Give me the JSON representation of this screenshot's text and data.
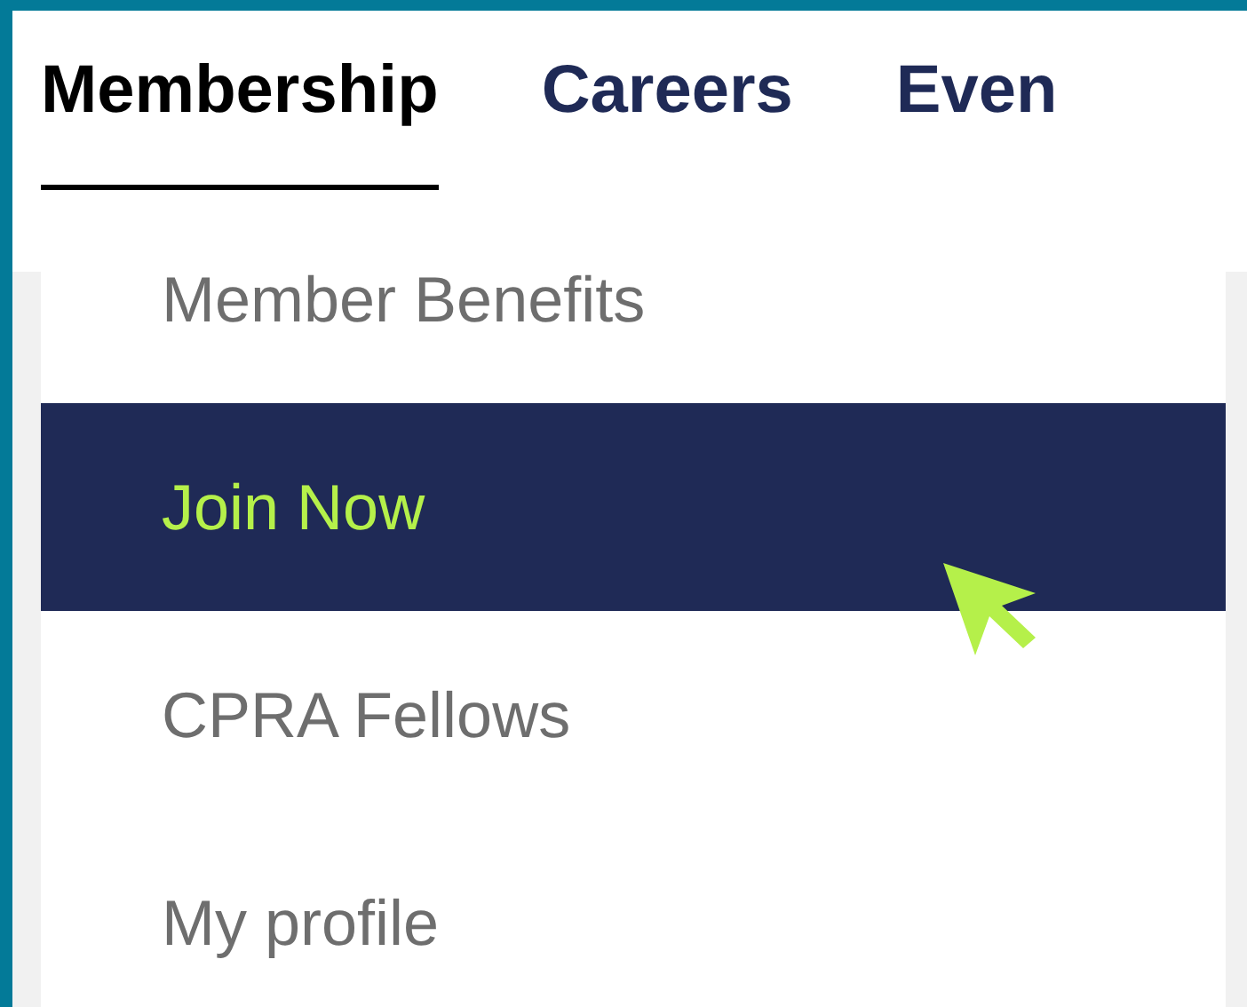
{
  "nav": {
    "tabs": [
      {
        "label": "Membership",
        "selected": true
      },
      {
        "label": "Careers",
        "selected": false
      },
      {
        "label": "Even",
        "selected": false
      }
    ]
  },
  "dropdown": {
    "items": [
      {
        "label": "Member Benefits",
        "selected": false
      },
      {
        "label": "Join Now",
        "selected": true
      },
      {
        "label": "CPRA Fellows",
        "selected": false
      },
      {
        "label": "My profile",
        "selected": false
      }
    ]
  }
}
